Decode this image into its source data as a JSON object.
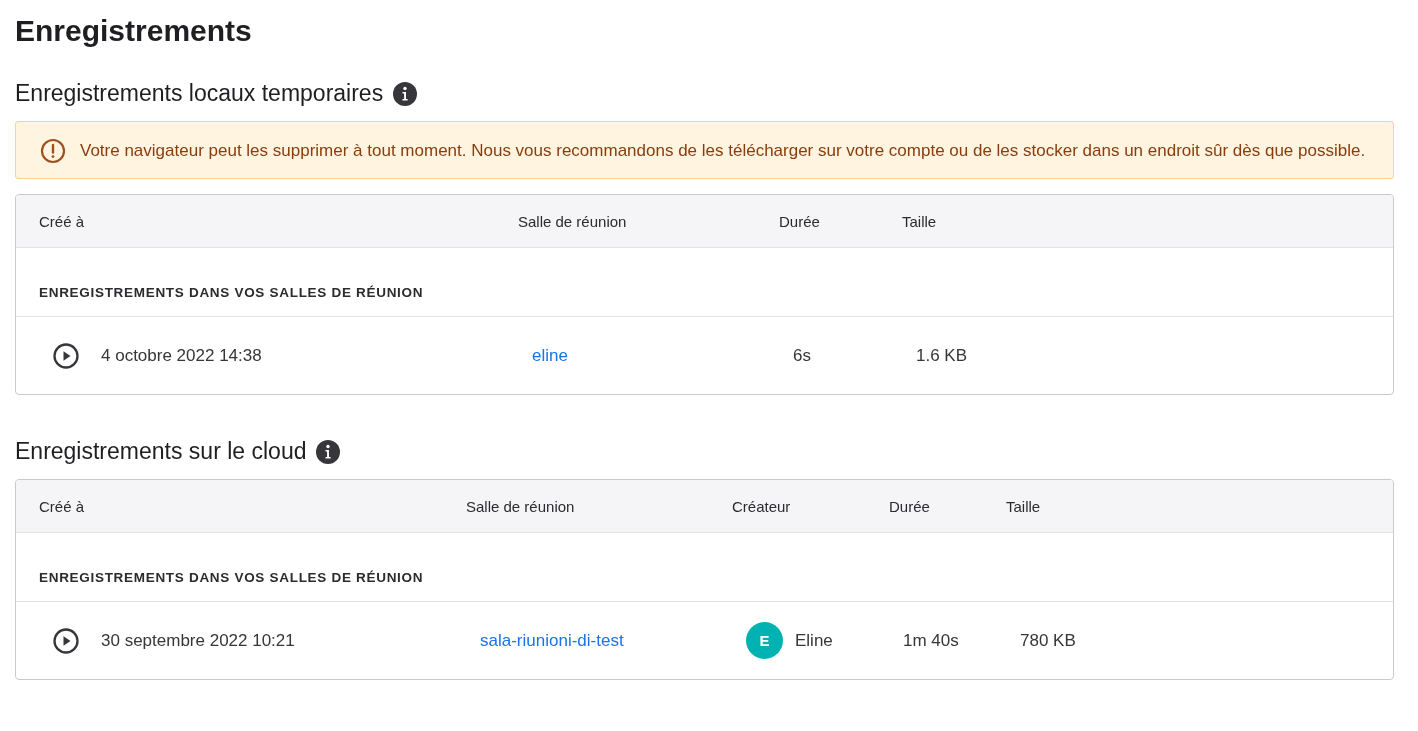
{
  "title": "Enregistrements",
  "sections": [
    {
      "heading": "Enregistrements locaux temporaires",
      "warning": "Votre navigateur peut les supprimer à tout moment. Nous vous recommandons de les télécharger sur votre compte ou de les stocker dans un endroit sûr dès que possible.",
      "columns": [
        "Créé à",
        "Salle de réunion",
        "Durée",
        "Taille"
      ],
      "group": "ENREGISTREMENTS DANS VOS SALLES DE RÉUNION",
      "rows": [
        {
          "cells": [
            {
              "kind": "date",
              "text": "4 octobre 2022 14:38"
            },
            {
              "kind": "link",
              "text": "eline"
            },
            {
              "kind": "text",
              "text": "6s"
            },
            {
              "kind": "text",
              "text": "1.6 KB"
            }
          ]
        }
      ]
    },
    {
      "heading": "Enregistrements sur le cloud",
      "columns": [
        "Créé à",
        "Salle de réunion",
        "Créateur",
        "Durée",
        "Taille"
      ],
      "group": "ENREGISTREMENTS DANS VOS SALLES DE RÉUNION",
      "rows": [
        {
          "cells": [
            {
              "kind": "date",
              "text": "30 septembre 2022 10:21"
            },
            {
              "kind": "link",
              "text": "sala-riunioni-di-test"
            },
            {
              "kind": "user",
              "initial": "E",
              "text": "Eline"
            },
            {
              "kind": "text",
              "text": "1m 40s"
            },
            {
              "kind": "text",
              "text": "780 KB"
            }
          ]
        }
      ]
    }
  ]
}
